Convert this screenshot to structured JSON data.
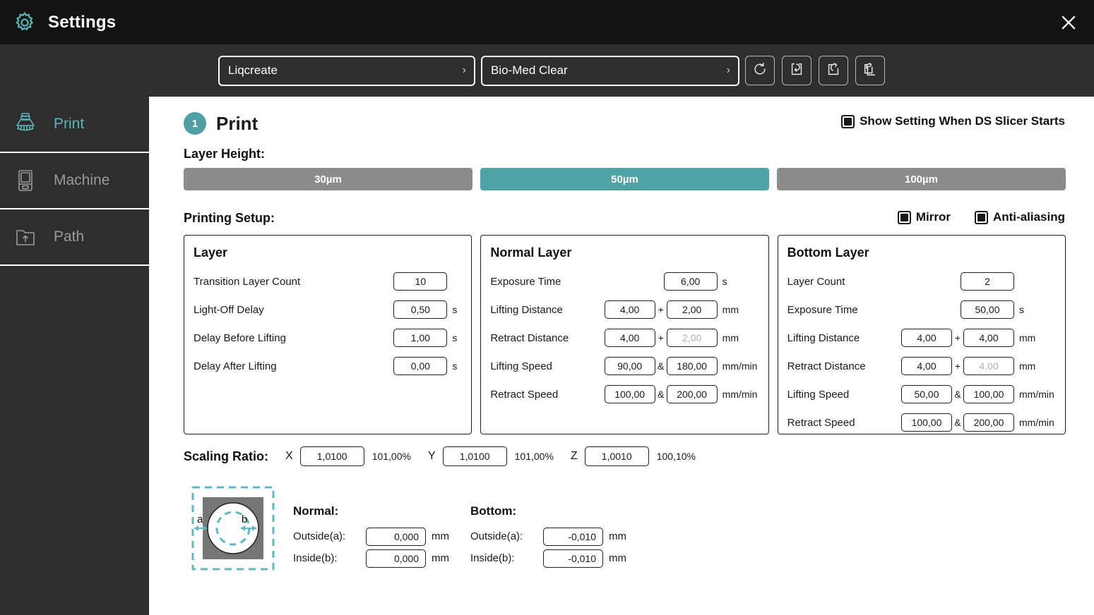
{
  "window": {
    "title": "Settings",
    "gear_icon": "gear-icon",
    "close_icon": "close-icon"
  },
  "toolbar": {
    "brand_select": {
      "value": "Liqcreate",
      "chevron": "chevron-right-icon"
    },
    "resin_select": {
      "value": "Bio-Med Clear",
      "chevron": "chevron-right-icon"
    },
    "buttons": [
      {
        "name": "reset-button",
        "icon": "reset-icon"
      },
      {
        "name": "import-button",
        "icon": "import-icon"
      },
      {
        "name": "export-button",
        "icon": "export-icon"
      },
      {
        "name": "export-all-button",
        "icon": "export-all-icon"
      }
    ]
  },
  "sidebar": {
    "items": [
      {
        "label": "Print",
        "icon": "printer-icon",
        "active": true
      },
      {
        "label": "Machine",
        "icon": "machine-icon",
        "active": false
      },
      {
        "label": "Path",
        "icon": "folder-upload-icon",
        "active": false
      }
    ]
  },
  "main": {
    "step_number": "1",
    "section_title": "Print",
    "show_setting": {
      "label": "Show Setting When DS Slicer Starts",
      "checked": true
    },
    "layer_height": {
      "label": "Layer Height:",
      "options": [
        "30µm",
        "50µm",
        "100µm"
      ],
      "selected": "50µm"
    },
    "printing_setup": {
      "label": "Printing Setup:",
      "mirror": {
        "label": "Mirror",
        "checked": true
      },
      "antialiasing": {
        "label": "Anti-aliasing",
        "checked": true
      }
    },
    "panels": {
      "layer": {
        "title": "Layer",
        "rows": [
          {
            "name": "Transition Layer Count",
            "v1": "10",
            "unit": ""
          },
          {
            "name": "Light-Off Delay",
            "v1": "0,50",
            "unit": "s"
          },
          {
            "name": "Delay Before Lifting",
            "v1": "1,00",
            "unit": "s"
          },
          {
            "name": "Delay After Lifting",
            "v1": "0,00",
            "unit": "s"
          }
        ]
      },
      "normal_layer": {
        "title": "Normal Layer",
        "rows": [
          {
            "name": "Exposure Time",
            "v1": "6,00",
            "unit": "s"
          },
          {
            "name": "Lifting Distance",
            "v1": "4,00",
            "op": "+",
            "v2": "2,00",
            "unit": "mm",
            "v2_disabled": false
          },
          {
            "name": "Retract Distance",
            "v1": "4,00",
            "op": "+",
            "v2": "2,00",
            "unit": "mm",
            "v2_disabled": true
          },
          {
            "name": "Lifting Speed",
            "v1": "90,00",
            "op": "&",
            "v2": "180,00",
            "unit": "mm/min",
            "v2_disabled": false
          },
          {
            "name": "Retract Speed",
            "v1": "100,00",
            "op": "&",
            "v2": "200,00",
            "unit": "mm/min",
            "v2_disabled": false
          }
        ]
      },
      "bottom_layer": {
        "title": "Bottom Layer",
        "rows": [
          {
            "name": "Layer Count",
            "v1": "2",
            "unit": ""
          },
          {
            "name": "Exposure Time",
            "v1": "50,00",
            "unit": "s"
          },
          {
            "name": "Lifting Distance",
            "v1": "4,00",
            "op": "+",
            "v2": "4,00",
            "unit": "mm",
            "v2_disabled": false
          },
          {
            "name": "Retract Distance",
            "v1": "4,00",
            "op": "+",
            "v2": "4,00",
            "unit": "mm",
            "v2_disabled": true
          },
          {
            "name": "Lifting Speed",
            "v1": "50,00",
            "op": "&",
            "v2": "100,00",
            "unit": "mm/min",
            "v2_disabled": false
          },
          {
            "name": "Retract Speed",
            "v1": "100,00",
            "op": "&",
            "v2": "200,00",
            "unit": "mm/min",
            "v2_disabled": false
          }
        ]
      }
    },
    "scaling_ratio": {
      "label": "Scaling Ratio:",
      "axes": [
        {
          "axis": "X",
          "value": "1,0100",
          "percent": "101,00%"
        },
        {
          "axis": "Y",
          "value": "1,0100",
          "percent": "101,00%"
        },
        {
          "axis": "Z",
          "value": "1,0010",
          "percent": "100,10%"
        }
      ]
    },
    "compensation": {
      "diagram": {
        "icon": "compensation-diagram-icon",
        "label_a": "a",
        "label_b": "b"
      },
      "normal": {
        "title": "Normal:",
        "outside": {
          "label": "Outside(a):",
          "value": "0,000",
          "unit": "mm"
        },
        "inside": {
          "label": "Inside(b):",
          "value": "0,000",
          "unit": "mm"
        }
      },
      "bottom": {
        "title": "Bottom:",
        "outside": {
          "label": "Outside(a):",
          "value": "-0,010",
          "unit": "mm"
        },
        "inside": {
          "label": "Inside(b):",
          "value": "-0,010",
          "unit": "mm"
        }
      }
    }
  },
  "colors": {
    "accent_teal": "#4fa3a4",
    "titlebar_bg": "#131313",
    "panel_bg": "#2e2e2e",
    "inactive_gray": "#8c8c8c"
  }
}
